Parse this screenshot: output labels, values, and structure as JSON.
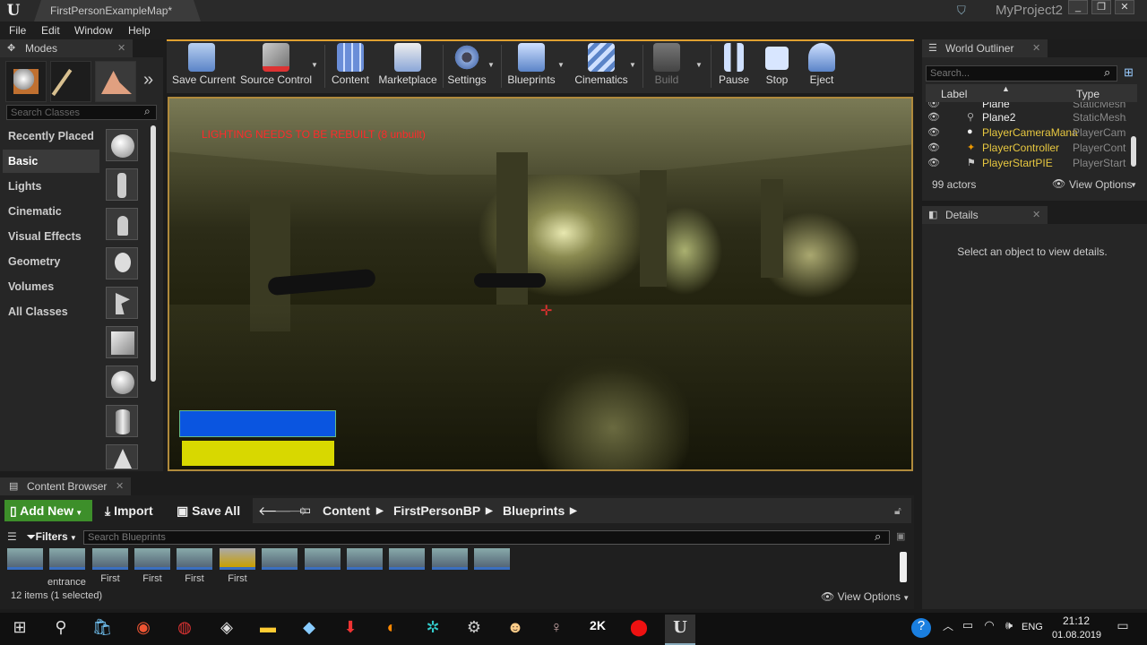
{
  "app": {
    "doc_tab": "FirstPersonExampleMap*",
    "project": "MyProject2"
  },
  "window_controls": [
    "_",
    "❐",
    "✕"
  ],
  "menu": [
    "File",
    "Edit",
    "Window",
    "Help"
  ],
  "modes": {
    "tab": "Modes",
    "search_placeholder": "Search Classes",
    "categories": [
      "Recently Placed",
      "Basic",
      "Lights",
      "Cinematic",
      "Visual Effects",
      "Geometry",
      "Volumes",
      "All Classes"
    ],
    "selected": "Basic"
  },
  "toolbar": {
    "items": [
      "Save Current",
      "Source Control",
      "Content",
      "Marketplace",
      "Settings",
      "Blueprints",
      "Cinematics",
      "Build",
      "Pause",
      "Stop",
      "Eject"
    ]
  },
  "viewport": {
    "warning": "LIGHTING NEEDS TO BE REBUILT (8 unbuilt)"
  },
  "outliner": {
    "tab": "World Outliner",
    "search_placeholder": "Search...",
    "col_label": "Label",
    "col_type": "Type",
    "rows": [
      {
        "label": "Plane",
        "type": "StaticMesh"
      },
      {
        "label": "Plane2",
        "type": "StaticMeshA"
      },
      {
        "label": "PlayerCameraMana",
        "type": "PlayerCame"
      },
      {
        "label": "PlayerController",
        "type": "PlayerContr"
      },
      {
        "label": "PlayerStartPIE",
        "type": "PlayerStartF"
      }
    ],
    "actor_count": "99 actors",
    "view_options": "View Options"
  },
  "details": {
    "tab": "Details",
    "message": "Select an object to view details."
  },
  "content_browser": {
    "tab": "Content Browser",
    "add_new": "Add New",
    "import": "Import",
    "save_all": "Save All",
    "breadcrumb": [
      "Content",
      "FirstPersonBP",
      "Blueprints"
    ],
    "filters": "Filters",
    "search_placeholder": "Search Blueprints",
    "assets": [
      "entrance",
      "First",
      "First",
      "First",
      "First"
    ],
    "items_count": "12 items (1 selected)",
    "view_options": "View Options"
  },
  "taskbar": {
    "time": "21:12",
    "date": "01.08.2019",
    "lang": "ENG"
  }
}
